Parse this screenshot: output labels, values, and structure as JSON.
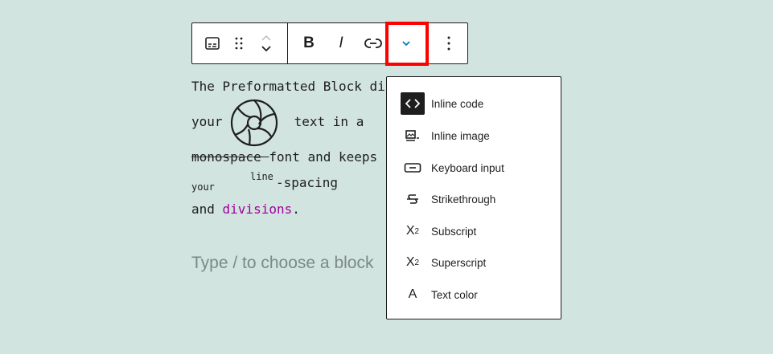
{
  "toolbar": {
    "buttons": [
      {
        "name": "block-type",
        "icon": "preformatted-icon"
      },
      {
        "name": "drag",
        "icon": "drag-handle-icon"
      },
      {
        "name": "move",
        "icon": "move-up-down-icon"
      },
      {
        "name": "bold",
        "label": "B"
      },
      {
        "name": "italic",
        "label": "I"
      },
      {
        "name": "link",
        "icon": "link-icon"
      },
      {
        "name": "more-rich-text",
        "icon": "chevron-down-icon",
        "highlighted": true
      },
      {
        "name": "options",
        "icon": "more-vertical-icon"
      }
    ],
    "accent": "#007cba",
    "highlight_color": "#ff0000"
  },
  "content": {
    "line1": "The Preformatted Block di",
    "line2a": "your ",
    "line2b": " text in a",
    "line3a": "monospace ",
    "line3b": "font and keeps",
    "line4a": "your",
    "line4b": "line",
    "line4c": "-spacing",
    "line5a": "and ",
    "line5b": "divisions",
    "line5c": ".",
    "placeholder": "Type / to choose a block",
    "link_color": "#a0009e"
  },
  "menu": {
    "items": [
      {
        "label": "Inline code",
        "icon": "code-icon",
        "active": true
      },
      {
        "label": "Inline image",
        "icon": "image-icon"
      },
      {
        "label": "Keyboard input",
        "icon": "keyboard-icon"
      },
      {
        "label": "Strikethrough",
        "icon": "strikethrough-icon"
      },
      {
        "label": "Subscript",
        "icon": "subscript-icon"
      },
      {
        "label": "Superscript",
        "icon": "superscript-icon"
      },
      {
        "label": "Text color",
        "icon": "text-color-icon"
      }
    ]
  },
  "background": "#d2e4df"
}
